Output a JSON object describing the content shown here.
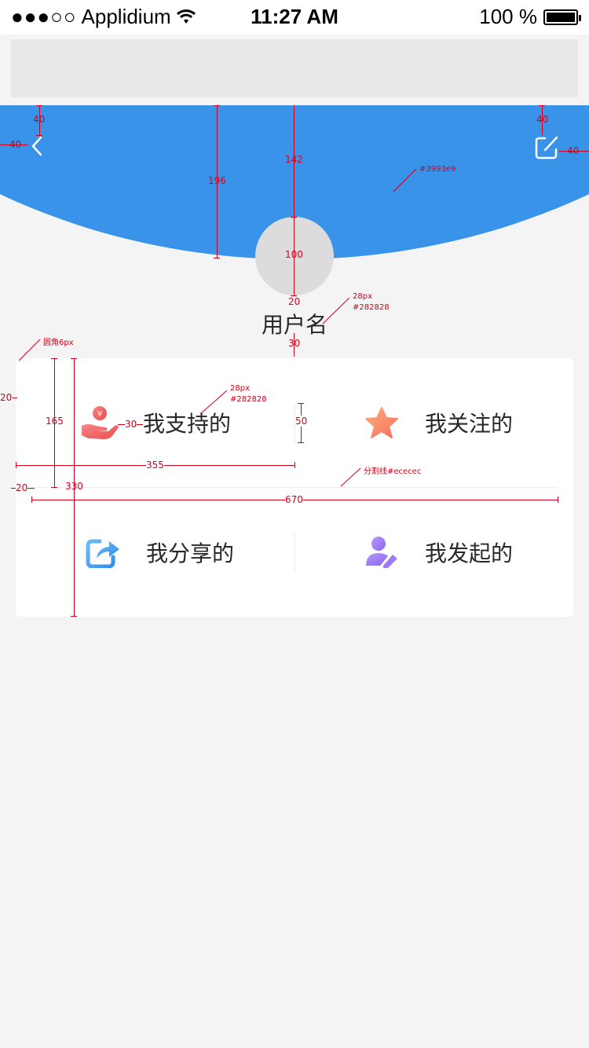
{
  "status_bar": {
    "signal": "●●●○○",
    "carrier": "Applidium",
    "time": "11:27 AM",
    "battery_text": "100 %",
    "battery_level": 1.0
  },
  "header": {
    "bg_color": "#3993e9"
  },
  "profile": {
    "username": "用户名"
  },
  "menu": {
    "items": [
      {
        "label": "我支持的",
        "icon": "support-coin-hand-icon",
        "color": "#f0615c"
      },
      {
        "label": "我关注的",
        "icon": "star-icon",
        "color": "#fc8a6b"
      },
      {
        "label": "我分享的",
        "icon": "share-icon",
        "color": "#3b9ef0"
      },
      {
        "label": "我发起的",
        "icon": "user-edit-icon",
        "color": "#9b7cf5"
      }
    ]
  },
  "annotations": {
    "top_40a": "40",
    "left_40": "40",
    "h196": "196",
    "h142": "142",
    "right_40a": "40",
    "right_40b": "40",
    "color_note": "#3993e9",
    "avatar_100": "100",
    "gap_20": "20",
    "font_note_1a": "28px",
    "font_note_1b": "#282828",
    "gap_30": "30",
    "radius_note": "圆角6px",
    "left_20a": "20",
    "h165": "165",
    "icon_gap_30": "30",
    "font_note_2a": "28px",
    "font_note_2b": "#282828",
    "h50": "50",
    "w355": "355",
    "divider_note": "分割线#ececec",
    "left_20b": "20",
    "h330": "330",
    "w670": "670"
  }
}
